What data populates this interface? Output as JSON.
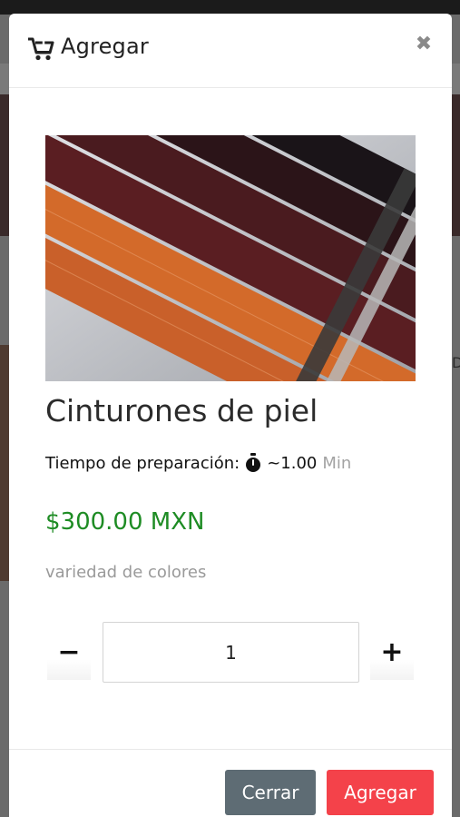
{
  "modal": {
    "title": "Agregar",
    "close_symbol": "✖"
  },
  "product": {
    "name": "Cinturones de piel",
    "prep_label": "Tiempo de preparación:",
    "prep_value": "~1.00",
    "prep_unit": "Min",
    "price": "$300.00 MXN",
    "description": "variedad de colores"
  },
  "quantity": {
    "value": "1",
    "minus_label": "−",
    "plus_label": "+"
  },
  "footer": {
    "close_label": "Cerrar",
    "add_label": "Agregar"
  },
  "background": {
    "side_text": "D"
  },
  "icons": {
    "header": "cart-plus-icon",
    "close": "close-icon",
    "timer": "stopwatch-icon"
  },
  "colors": {
    "price": "#1e8c24",
    "close_button": "#5e6c74",
    "add_button": "#f4424a"
  }
}
